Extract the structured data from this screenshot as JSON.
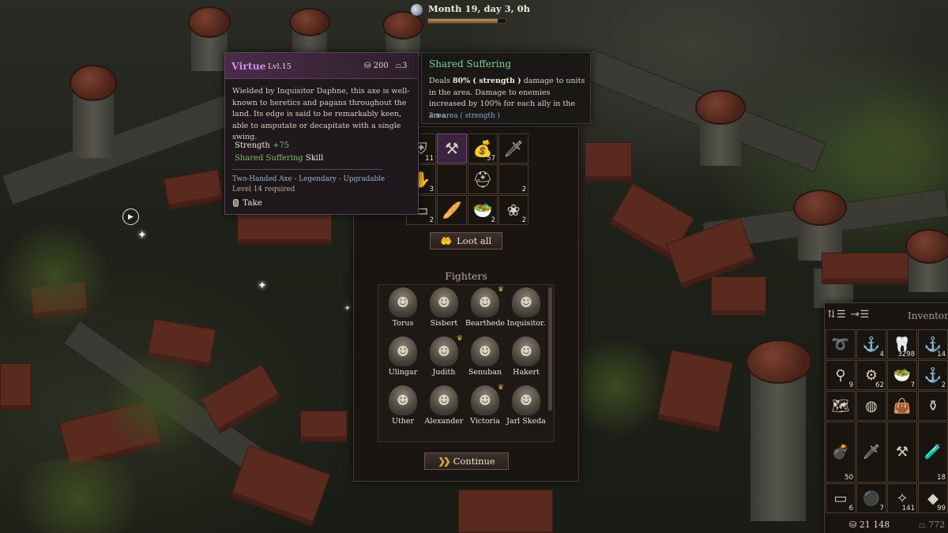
{
  "time": {
    "label": "Month 19, day 3, 0h",
    "progress": 0.9
  },
  "item_tooltip": {
    "name": "Virtue",
    "level": "Lvl.15",
    "price": "200",
    "weight": "3",
    "description": "Wielded by Inquisitor Daphne, this axe is well-known to heretics and pagans throughout the land. Its edge is said to be remarkably keen, able to amputate or decapitate with a single swing.",
    "stat_label": "Strength",
    "stat_value": "+75",
    "skill_name": "Shared Suffering",
    "skill_suffix": "Skill",
    "type_line": "Two-Handed Axe - Legendary - Upgradable",
    "requirement": "Level 14 required",
    "take_label": "Take",
    "name_color": "#d38ce0"
  },
  "skill_tooltip": {
    "title": "Shared Suffering",
    "desc_prefix": "Deals",
    "desc_percent": "80% ( strength )",
    "desc_rest": "damage to units in the area. Damage to enemies increased by 100% for each ally in the area.",
    "area": "2m area ( strength )"
  },
  "loot": {
    "slots": [
      {
        "icon": "armor-piece-icon",
        "glyph": "⛨",
        "count": "11"
      },
      {
        "icon": "axe-icon",
        "glyph": "⚒",
        "count": "",
        "highlight": true
      },
      {
        "icon": "coin-pouch-icon",
        "glyph": "💰",
        "count": "57"
      },
      {
        "icon": "sword-icon",
        "glyph": "🗡",
        "count": ""
      },
      {
        "icon": "glove-icon",
        "glyph": "✋",
        "count": "3"
      },
      {
        "icon": "axe-lower-icon",
        "glyph": "",
        "count": ""
      },
      {
        "icon": "helmet-icon",
        "glyph": "⛑",
        "count": ""
      },
      {
        "icon": "sword-lower-icon",
        "glyph": "",
        "count": "2"
      },
      {
        "icon": "cloth-icon",
        "glyph": "▭",
        "count": "2"
      },
      {
        "icon": "ration-icon",
        "glyph": "🥖",
        "count": ""
      },
      {
        "icon": "food-bowl-icon",
        "glyph": "🥗",
        "count": "2"
      },
      {
        "icon": "herb-icon",
        "glyph": "❀",
        "count": "2"
      }
    ],
    "loot_all_label": "Loot all",
    "fighters_title": "Fighters",
    "continue_label": "Continue"
  },
  "fighters": [
    {
      "name": "Torus",
      "crown": false
    },
    {
      "name": "Sisbert",
      "crown": false
    },
    {
      "name": "Bearthede",
      "crown": true
    },
    {
      "name": "Inquisitor.",
      "crown": false
    },
    {
      "name": "Ulingar",
      "crown": false
    },
    {
      "name": "Judith",
      "crown": true
    },
    {
      "name": "Senuban",
      "crown": false
    },
    {
      "name": "Hakert",
      "crown": false
    },
    {
      "name": "Uther",
      "crown": false
    },
    {
      "name": "Alexander",
      "crown": false
    },
    {
      "name": "Victoria",
      "crown": true
    },
    {
      "name": "Jarl Skeda",
      "crown": false
    }
  ],
  "inventory": {
    "title": "Inventory",
    "sort_glyph": "⇅☰ ⇥☰",
    "money": "21 148",
    "weight": "772",
    "slots": [
      {
        "icon": "rope-icon",
        "glyph": "➰",
        "count": ""
      },
      {
        "icon": "hook-icon",
        "glyph": "⚓",
        "count": "4"
      },
      {
        "icon": "fang-icon",
        "glyph": "🦷",
        "count": "3298"
      },
      {
        "icon": "hook-small-icon",
        "glyph": "⚓",
        "count": "14"
      },
      {
        "icon": "tongs-icon",
        "glyph": "⚲",
        "count": "9"
      },
      {
        "icon": "gears-icon",
        "glyph": "⚙",
        "count": "62"
      },
      {
        "icon": "food-bowl-icon",
        "glyph": "🥗",
        "count": "7"
      },
      {
        "icon": "hook-alt-icon",
        "glyph": "⚓",
        "count": "2"
      },
      {
        "icon": "map-scroll-icon",
        "glyph": "🗺",
        "count": ""
      },
      {
        "icon": "belt-icon",
        "glyph": "◍",
        "count": ""
      },
      {
        "icon": "bag-icon",
        "glyph": "👜",
        "count": ""
      },
      {
        "icon": "pot-icon",
        "glyph": "⚱",
        "count": ""
      },
      {
        "icon": "bomb-icon",
        "glyph": "💣",
        "count": "50",
        "tall": true
      },
      {
        "icon": "dagger-icon",
        "glyph": "🗡",
        "count": "",
        "tall": true
      },
      {
        "icon": "mace-icon",
        "glyph": "⚒",
        "count": "",
        "tall": true
      },
      {
        "icon": "potion-icon",
        "glyph": "🧪",
        "count": "18",
        "tall": true
      },
      {
        "icon": "bandage-icon",
        "glyph": "▭",
        "count": "6"
      },
      {
        "icon": "coal-bowl-icon",
        "glyph": "⚫",
        "count": "7"
      },
      {
        "icon": "scrap-icon",
        "glyph": "✧",
        "count": "141"
      },
      {
        "icon": "stone-icon",
        "glyph": "◆",
        "count": "99"
      }
    ]
  }
}
